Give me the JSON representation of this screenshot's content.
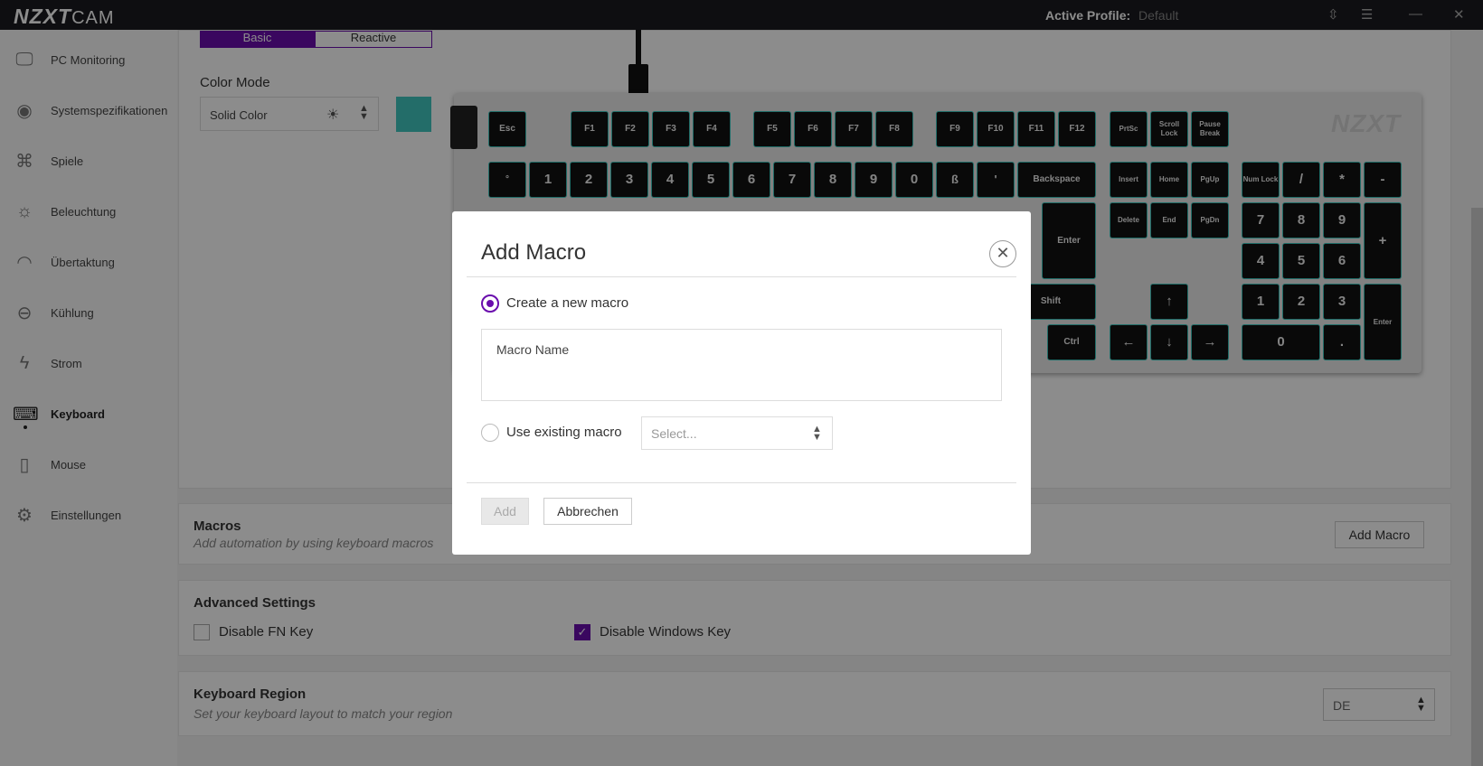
{
  "titlebar": {
    "logo_bold": "NZXT",
    "logo_light": "CAM",
    "profile_label": "Active Profile:",
    "profile_value": "Default",
    "icons": [
      "sort-icon",
      "menu-icon",
      "minimize-icon",
      "close-icon"
    ]
  },
  "sidebar": {
    "items": [
      {
        "label": "PC Monitoring",
        "icon": "monitor-icon"
      },
      {
        "label": "Systemspezifikationen",
        "icon": "eye-icon"
      },
      {
        "label": "Spiele",
        "icon": "gamepad-icon"
      },
      {
        "label": "Beleuchtung",
        "icon": "sun-icon"
      },
      {
        "label": "Übertaktung",
        "icon": "speedometer-icon"
      },
      {
        "label": "Kühlung",
        "icon": "fan-icon"
      },
      {
        "label": "Strom",
        "icon": "bolt-icon"
      },
      {
        "label": "Keyboard",
        "icon": "keyboard-icon"
      },
      {
        "label": "Mouse",
        "icon": "mouse-icon"
      },
      {
        "label": "Einstellungen",
        "icon": "gear-icon"
      }
    ],
    "active": "Keyboard"
  },
  "lighting": {
    "mode_basic": "Basic",
    "mode_reactive": "Reactive",
    "color_mode_label": "Color Mode",
    "color_mode_value": "Solid Color",
    "swatch_color": "#41c7c0"
  },
  "keyboard": {
    "logo": "NZXT",
    "accent": "#3bc6bd",
    "rows": {
      "fn": [
        "Esc",
        "F1",
        "F2",
        "F3",
        "F4",
        "F5",
        "F6",
        "F7",
        "F8",
        "F9",
        "F10",
        "F11",
        "F12",
        "PrtSc",
        "Scroll Lock",
        "Pause Break"
      ],
      "num": [
        "°",
        "1",
        "2",
        "3",
        "4",
        "5",
        "6",
        "7",
        "8",
        "9",
        "0",
        "ß",
        "'",
        "Backspace",
        "Insert",
        "Home",
        "PgUp",
        "Num Lock",
        "/",
        "*",
        "-"
      ],
      "nav2": [
        "Delete",
        "End",
        "PgDn",
        "Enter",
        "7",
        "8",
        "9",
        "+"
      ],
      "mid": [
        "4",
        "5",
        "6"
      ],
      "shift": [
        "Shift",
        "↑",
        "1",
        "2",
        "3",
        "Enter"
      ],
      "bottom": [
        "Ctrl",
        "←",
        "↓",
        "→",
        "0",
        "."
      ]
    }
  },
  "macros": {
    "title": "Macros",
    "subtitle": "Add automation by using keyboard macros",
    "add_button": "Add Macro"
  },
  "advanced": {
    "title": "Advanced Settings",
    "disable_fn_label": "Disable FN Key",
    "disable_fn_checked": false,
    "disable_win_label": "Disable Windows Key",
    "disable_win_checked": true
  },
  "region": {
    "title": "Keyboard Region",
    "subtitle": "Set your keyboard layout to match your region",
    "value": "DE"
  },
  "modal": {
    "title": "Add Macro",
    "option_new": "Create a new macro",
    "option_new_selected": true,
    "macro_name_placeholder": "Macro Name",
    "option_existing": "Use existing macro",
    "existing_placeholder": "Select...",
    "add_button": "Add",
    "cancel_button": "Abbrechen"
  }
}
